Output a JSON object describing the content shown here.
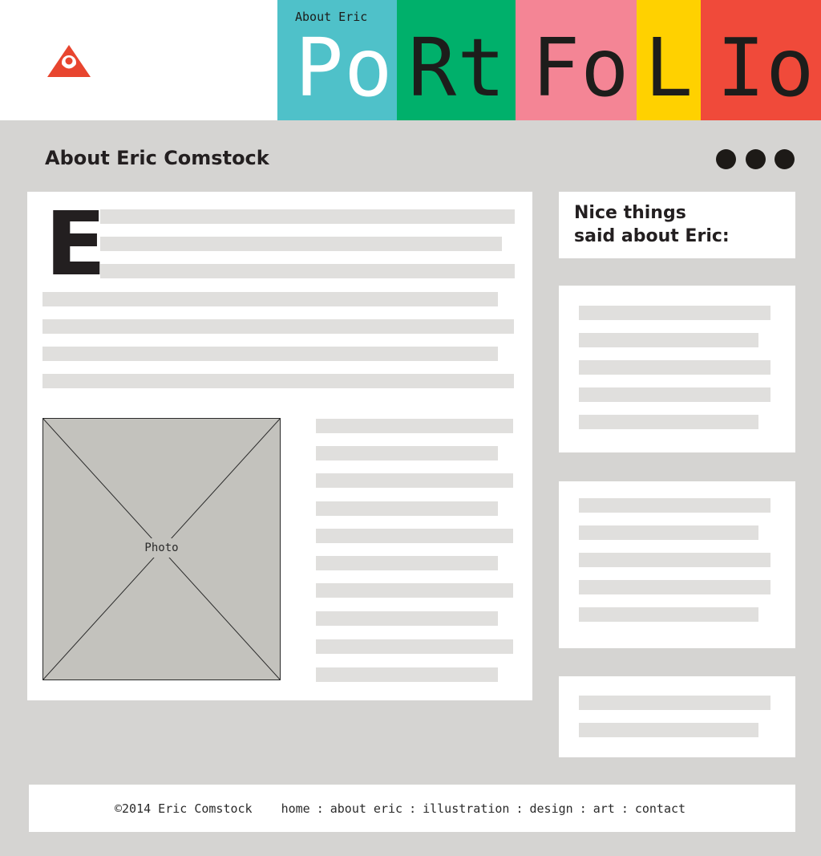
{
  "header": {
    "about_label": "About Eric",
    "logo_icon": "eye-triangle-icon",
    "portfolio_blocks": [
      {
        "text": "Po",
        "bg": "#4fc1c9",
        "color": "#ffffff"
      },
      {
        "text": "Rt",
        "bg": "#00b06b",
        "color": "#1d1d1b"
      },
      {
        "text": "Fo",
        "bg": "#f48595",
        "color": "#1d1d1b"
      },
      {
        "text": "L",
        "bg": "#ffd100",
        "color": "#1d1d1b"
      },
      {
        "text": "Io",
        "bg": "#f04a3a",
        "color": "#1d1d1b"
      }
    ]
  },
  "main": {
    "title": "About Eric Comstock",
    "more_icon": "more-dots-icon",
    "drop_cap": "E",
    "photo_label": "Photo"
  },
  "sidebar": {
    "title_line1": "Nice things",
    "title_line2": "said about Eric:"
  },
  "footer": {
    "copyright": "©2014 Eric Comstock",
    "nav": [
      {
        "label": "home"
      },
      {
        "label": "about eric"
      },
      {
        "label": "illustration"
      },
      {
        "label": "design"
      },
      {
        "label": "art"
      },
      {
        "label": "contact"
      }
    ],
    "separator": ":"
  },
  "colors": {
    "background": "#d5d4d2",
    "placeholder_line": "#e0dfdd",
    "photo_fill": "#c3c2bd",
    "accent_red": "#e8452f"
  }
}
